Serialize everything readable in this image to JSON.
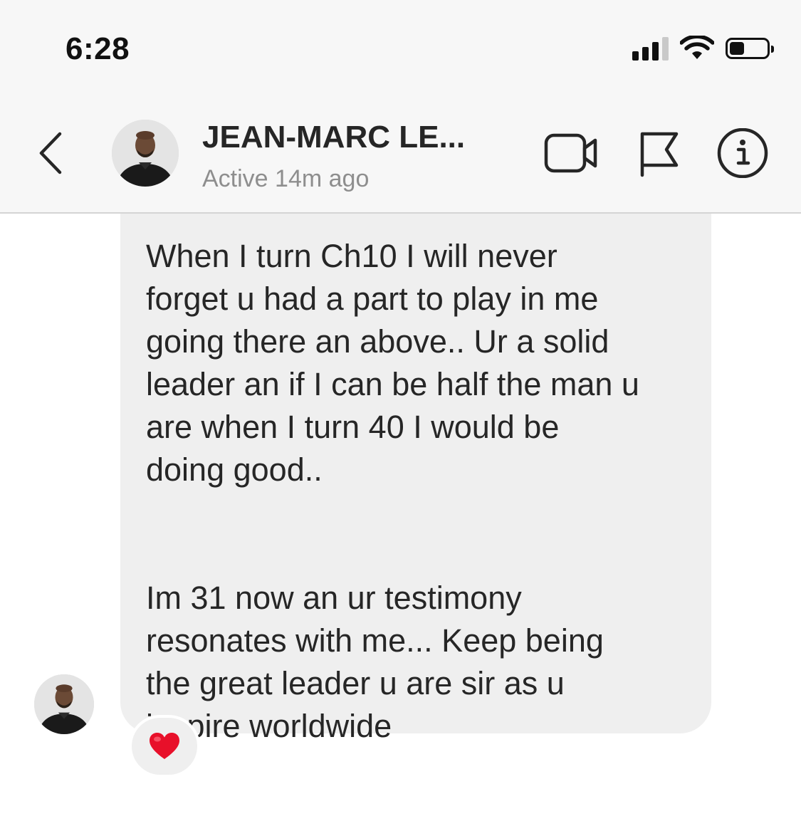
{
  "status_bar": {
    "time": "6:28",
    "battery_level": 0.42
  },
  "header": {
    "contact_name": "JEAN-MARC LE...",
    "contact_status": "Active 14m ago",
    "icons": {
      "back": "chevron-left-icon",
      "video": "video-camera-icon",
      "flag": "flag-icon",
      "info": "info-icon"
    }
  },
  "thread": {
    "message": {
      "text": "When I turn Ch10 I will never\nforget u had a part to play in me\ngoing there an above.. Ur a solid\nleader an if I can be half the man u\nare when I turn 40 I would be\ndoing good..\n\n\nIm 31 now an ur testimony\nresonates with me... Keep being\nthe great leader u are sir as u\ninspire worldwide",
      "reaction": "❤️"
    }
  },
  "colors": {
    "bar_background": "#f7f7f7",
    "bubble": "#efefef",
    "text": "#262626",
    "secondary_text": "#8e8e8e",
    "reaction_heart": "#e8102a"
  }
}
